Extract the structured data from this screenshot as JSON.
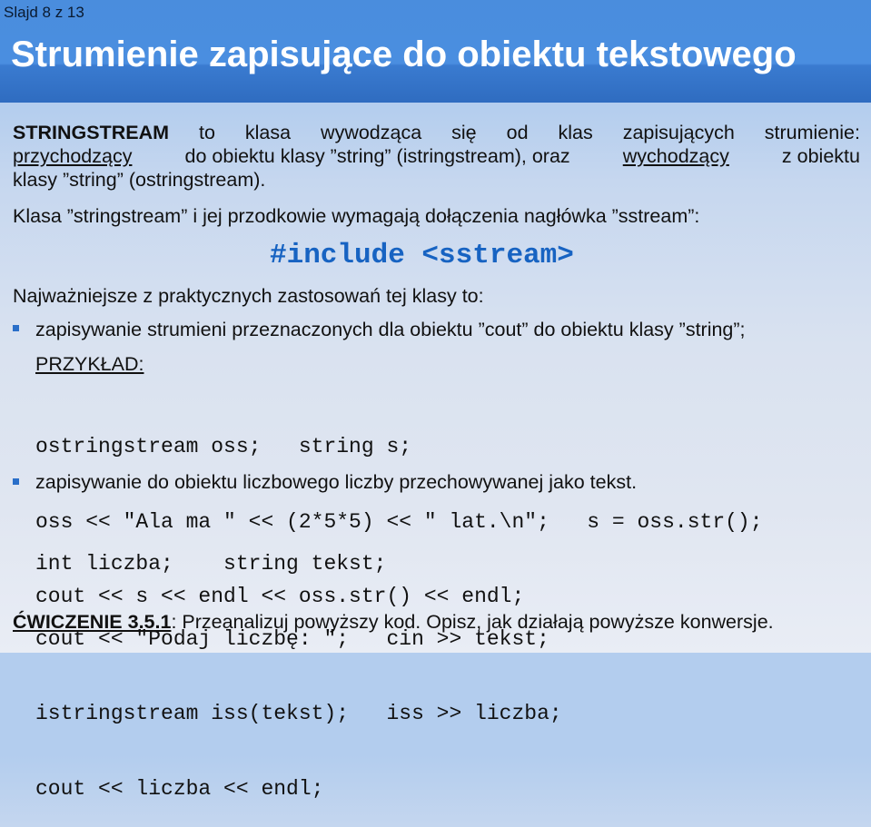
{
  "header": {
    "slide_counter": "Slajd 8 z 13",
    "title": "Strumienie zapisujące do obiektu tekstowego"
  },
  "intro": {
    "line1": [
      "STRINGSTREAM",
      "to",
      "klasa",
      "wywodząca",
      "się",
      "od",
      "klas",
      "zapisujących",
      "strumienie:"
    ],
    "line2": {
      "incoming": "przychodzący",
      "mid": "do obiektu klasy ”string” (istringstream), oraz",
      "outgoing": "wychodzący",
      "end": "z obiektu"
    },
    "line3": "klasy ”string” (ostringstream)."
  },
  "header_note": "Klasa ”stringstream” i jej przodkowie wymagają dołączenia nagłówka ”sstream”:",
  "include_line": "#include <sstream>",
  "uses_intro": "Najważniejsze z praktycznych zastosowań tej klasy to:",
  "bullets": [
    {
      "text": "zapisywanie strumieni przeznaczonych dla obiektu ”cout” do obiektu klasy ”string”;",
      "example_label": "PRZYKŁAD:",
      "code": [
        "ostringstream oss;   string s;",
        "oss << \"Ala ma \" << (2*5*5) << \" lat.\\n\";   s = oss.str();",
        "cout << s << endl << oss.str() << endl;"
      ]
    },
    {
      "text": "zapisywanie do obiektu liczbowego liczby przechowywanej jako tekst.",
      "code": [
        "int liczba;    string tekst;",
        "cout << \"Podaj liczbę: \";   cin >> tekst;",
        "istringstream iss(tekst);   iss >> liczba;",
        "cout << liczba << endl;"
      ]
    }
  ],
  "exercise": {
    "label": "ĆWICZENIE 3.5.1",
    "text": ": Przeanalizuj powyższy kod. Opisz, jak działają powyższe konwersje."
  },
  "colors": {
    "header_blue": "#4a8ddd",
    "include_blue": "#1763c2",
    "bullet_blue": "#2a6fc9"
  }
}
